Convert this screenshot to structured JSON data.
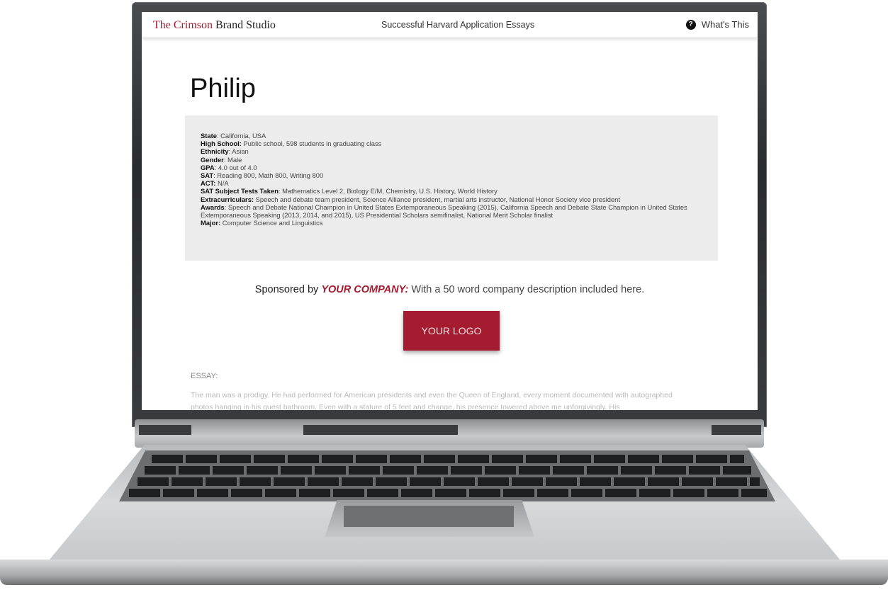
{
  "header": {
    "brand_accent": "The Crimson",
    "brand_rest": " Brand Studio",
    "center_title": "Successful Harvard Application Essays",
    "help_icon": "?",
    "help_label": "What's This"
  },
  "profile": {
    "name": "Philip",
    "fields": [
      {
        "key": "State",
        "sep": ": ",
        "value": "California, USA"
      },
      {
        "key": "High School:",
        "sep": " ",
        "value": "Public school, 598 students in graduating class"
      },
      {
        "key": "Ethnicity",
        "sep": ": ",
        "value": "Asian"
      },
      {
        "key": "Gender",
        "sep": ": ",
        "value": "Male"
      },
      {
        "key": "GPA",
        "sep": ": ",
        "value": "4.0 out of 4.0"
      },
      {
        "key": "SAT",
        "sep": ": ",
        "value": "Reading 800, Math 800, Writing 800"
      },
      {
        "key": "ACT:",
        "sep": " ",
        "value": "N/A"
      },
      {
        "key": "SAT Subject Tests Taken",
        "sep": ": ",
        "value": "Mathematics Level 2, Biology E/M, Chemistry, U.S. History, World History"
      },
      {
        "key": "Extracurriculars:",
        "sep": " ",
        "value": "Speech and debate team president, Science Alliance president, martial arts instructor, National Honor Society vice president"
      },
      {
        "key": "Awards",
        "sep": ": ",
        "value": "Speech and Debate National Champion in United States Extemporaneous Speaking (2015), California Speech and Debate State Champion in United States Extemporaneous Speaking (2013, 2014, and 2015), US Presidential Scholars semifinalist, National Merit Scholar finalist"
      },
      {
        "key": "Major:",
        "sep": " ",
        "value": "Computer Science and Linguistics"
      }
    ]
  },
  "sponsor": {
    "lead": "Sponsored by ",
    "company": "YOUR COMPANY:",
    "description": " With a 50 word company description included here.",
    "logo_label": "YOUR LOGO"
  },
  "essay": {
    "label": "ESSAY:",
    "text": "The man was a prodigy. He had performed for American presidents and even the Queen of England, every moment documented with autographed photos hanging in his guest bathroom. Even with a stature of 5 feet and change, his presence towered above me unforgivingly. His"
  },
  "colors": {
    "accent": "#a51c30",
    "profile_bg": "#ececec"
  }
}
